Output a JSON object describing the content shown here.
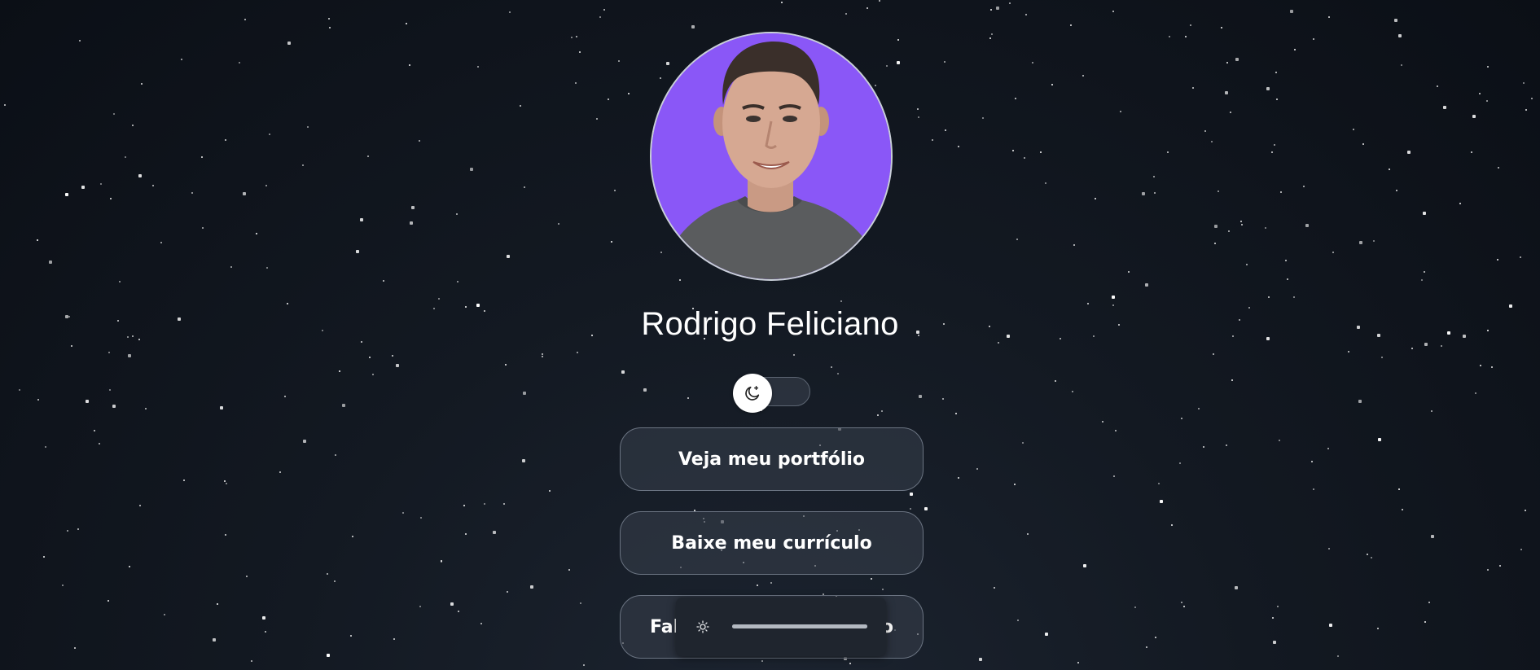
{
  "profile": {
    "name": "Rodrigo Feliciano",
    "avatar_alt": "Rodrigo Feliciano"
  },
  "theme_toggle": {
    "icon": "moon-icon",
    "state": "dark"
  },
  "links": [
    {
      "label": "Veja meu portfólio"
    },
    {
      "label": "Baixe meu currículo"
    },
    {
      "label_visible_start": "Fal",
      "label_visible_end": "o"
    }
  ],
  "brightness_popup": {
    "icon": "sun-icon",
    "level": 1.0
  },
  "colors": {
    "background": "#0f141c",
    "avatar_background": "#8a57f7",
    "button_border": "#6b7482",
    "text": "#ffffff"
  }
}
